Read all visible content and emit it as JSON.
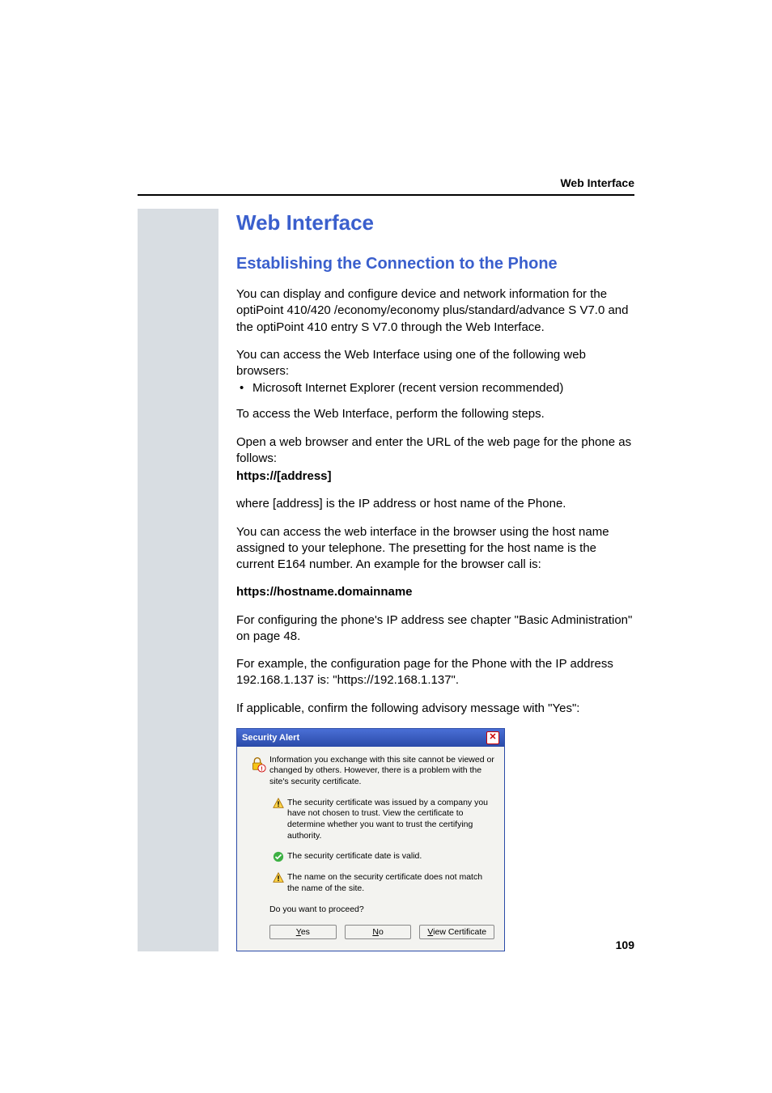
{
  "header": {
    "running_title": "Web Interface"
  },
  "h1": "Web Interface",
  "h2": "Establishing the Connection to the Phone",
  "p1": "You can display and configure device and network information for the optiPoint 410/420 /economy/economy plus/standard/advance S V7.0 and the optiPoint 410 entry S V7.0 through the Web Interface.",
  "p2": "You can access the Web Interface using one of the following web browsers:",
  "bullet1": "Microsoft Internet Explorer (recent version recommended)",
  "p3": "To access the Web Interface, perform the following steps.",
  "p4a": "Open a web browser and enter the URL of the web page for the phone as follows:",
  "p4b": "https://[address]",
  "p5": "where [address] is the IP address or host name of the Phone.",
  "p6": "You can access the web interface in the browser using the host name assigned to your telephone. The presetting for the host name is the current E164 number. An example for the browser call is:",
  "p7": "https://hostname.domainname",
  "p8": "For configuring the phone's IP address see chapter \"Basic Administration\" on page 48.",
  "p9": "For example, the configuration page for the Phone with the IP address 192.168.1.137 is: \"https://192.168.1.137\".",
  "p10": "If applicable, confirm the following advisory message with \"Yes\":",
  "dialog": {
    "title": "Security Alert",
    "intro": "Information you exchange with this site cannot be viewed or changed by others. However, there is a problem with the site's security certificate.",
    "item1": "The security certificate was issued by a company you have not chosen to trust. View the certificate to determine whether you want to trust the certifying authority.",
    "item2": "The security certificate date is valid.",
    "item3": "The name on the security certificate does not match the name of the site.",
    "proceed": "Do you want to proceed?",
    "yes": "Yes",
    "no": "No",
    "view": "View Certificate"
  },
  "page_number": "109"
}
